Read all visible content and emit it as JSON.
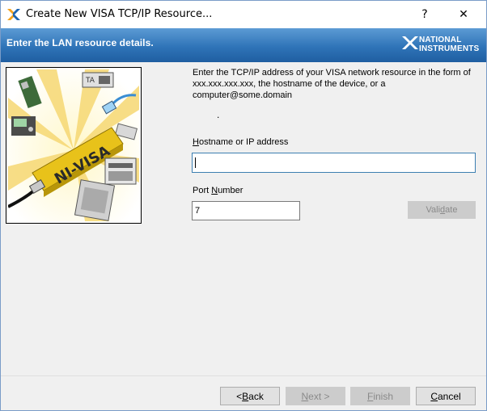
{
  "window": {
    "title": "Create New VISA TCP/IP Resource...",
    "help": "?",
    "close": "✕"
  },
  "header": {
    "text": "Enter the LAN resource details.",
    "logo_line1": "NATIONAL",
    "logo_line2": "INSTRUMENTS"
  },
  "picture": {
    "banner_text": "NI-VISA",
    "device_label": "TA"
  },
  "instructions": "Enter the TCP/IP address of your VISA network resource in the form of xxx.xxx.xxx.xxx, the hostname of the device, or a computer@some.domain",
  "stray_dot": ".",
  "hostname": {
    "label_accel": "H",
    "label_rest": "ostname or IP address",
    "value": ""
  },
  "port": {
    "label_pre": "Port ",
    "label_accel": "N",
    "label_rest": "umber",
    "value": "7"
  },
  "validate": {
    "pre": "Vali",
    "accel": "d",
    "rest": "ate"
  },
  "buttons": {
    "back": {
      "pre": "< ",
      "accel": "B",
      "rest": "ack"
    },
    "next": {
      "accel": "N",
      "rest": "ext >"
    },
    "finish": {
      "accel": "F",
      "rest": "inish"
    },
    "cancel": {
      "accel": "C",
      "rest": "ancel"
    }
  },
  "colors": {
    "header_top": "#5c9bd4",
    "header_bottom": "#1f5ea1",
    "focus_border": "#3c7fb1",
    "disabled_text": "#8a8a8a"
  }
}
